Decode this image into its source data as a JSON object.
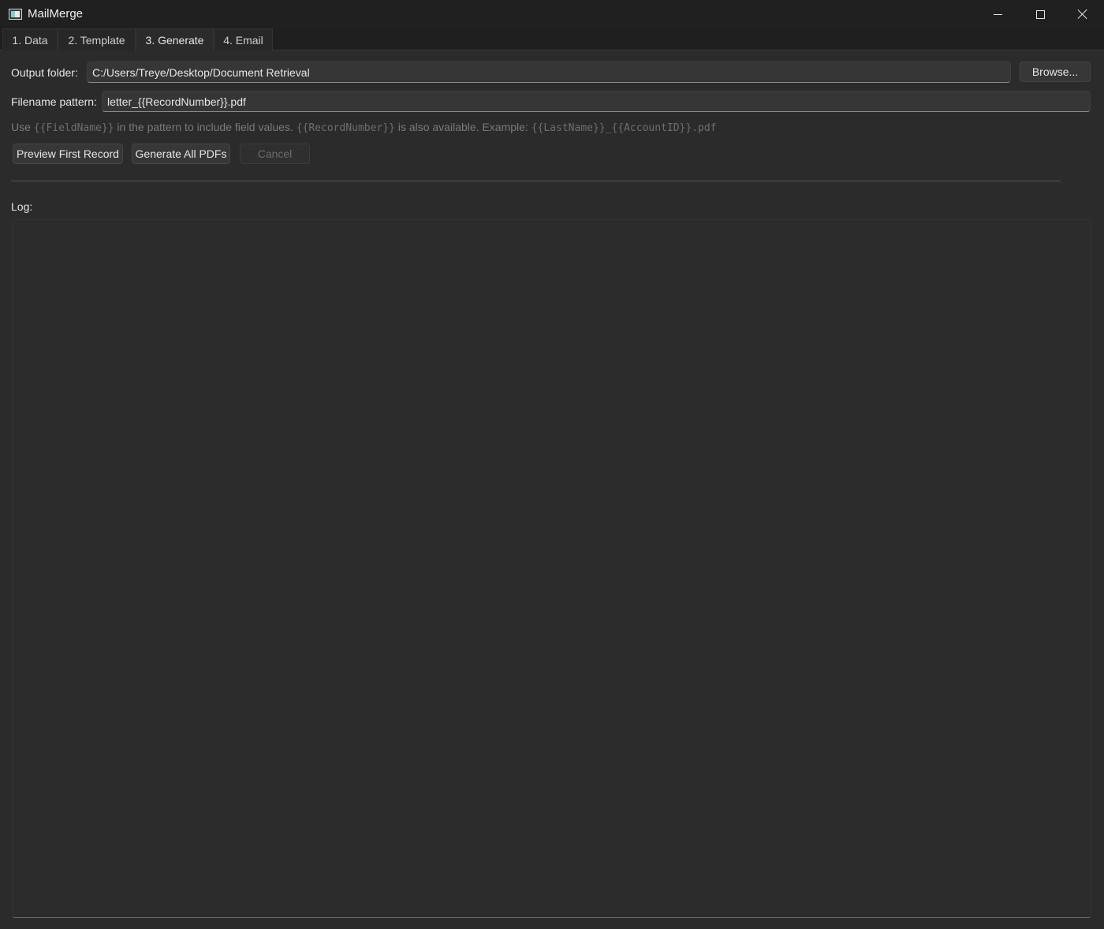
{
  "window": {
    "title": "MailMerge"
  },
  "tabs": [
    {
      "label": "1. Data"
    },
    {
      "label": "2. Template"
    },
    {
      "label": "3. Generate"
    },
    {
      "label": "4. Email"
    }
  ],
  "active_tab": "3. Generate",
  "output_folder": {
    "label": "Output folder:",
    "value": "C:/Users/Treye/Desktop/Document Retrieval",
    "browse_label": "Browse..."
  },
  "filename_pattern": {
    "label": "Filename pattern:",
    "value": "letter_{{RecordNumber}}.pdf"
  },
  "hint": {
    "part1": "Use ",
    "code1": "{{FieldName}}",
    "part2": " in the pattern to include field values. ",
    "code2": "{{RecordNumber}}",
    "part3": " is also available. Example: ",
    "code3": "{{LastName}}_{{AccountID}}.pdf"
  },
  "actions": {
    "preview_label": "Preview First Record",
    "generate_label": "Generate All PDFs",
    "cancel_label": "Cancel"
  },
  "log": {
    "label": "Log:",
    "content": ""
  },
  "colors": {
    "background": "#2b2b2b",
    "titlebar": "#202020",
    "text": "#e6e6e6",
    "muted": "#7a7a7a"
  }
}
